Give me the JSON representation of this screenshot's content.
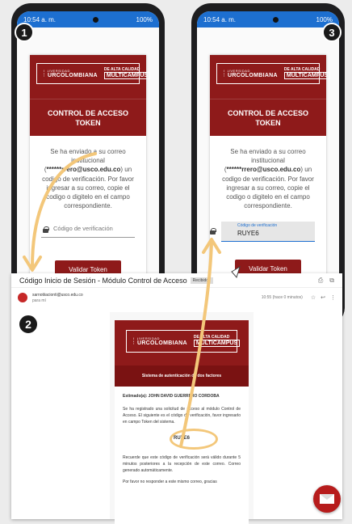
{
  "phone_left": {
    "status_time": "10:54 a. m.",
    "status_battery": "100%",
    "step_number": "1",
    "logo": {
      "small": "UNIVERSIDAD",
      "big": "SURCOLOMBIANA",
      "quality": "DE ALTA CALIDAD",
      "multi": "MULTICAMPUS"
    },
    "title_line1": "CONTROL DE ACCESO",
    "title_line2": "TOKEN",
    "msg_part1": "Se ha enviado a su correo institucional (",
    "msg_email": "******rrero@usco.edu.co",
    "msg_part2": ") un codigo de verificación. Por favor ingresar a su correo, copie el codigo o digitelo en el campo correspondiente.",
    "field_placeholder": "Código de verificación",
    "button_label": "Validar Token"
  },
  "phone_right": {
    "status_time": "10:54 a. m.",
    "status_battery": "100%",
    "step_number": "3",
    "title_line1": "CONTROL DE ACCESO",
    "title_line2": "TOKEN",
    "msg_part1": "Se ha enviado a su correo institucional (",
    "msg_email": "******rrero@usco.edu.co",
    "msg_part2": ") un codigo de verificación. Por favor ingresar a su correo, copie el codigo o digitelo en el campo correspondiente.",
    "field_label": "Código de verificación",
    "field_value": "RUYE6",
    "button_label": "Validar Token"
  },
  "email": {
    "step_number": "2",
    "subject": "Código Inicio de Sesión - Módulo Control de Acceso",
    "tag": "Recibidos",
    "sender": "sarnotiiacionti@usco.edu.co",
    "recipient": "para mí",
    "time": "10:55 (hace 0 minutos)",
    "band_text": "Sistema de autenticación de dos factores",
    "greeting": "Estimado(a): JOHN DAVID GUERRERO CORDOBA",
    "para1": "Se ha registrado una solicitud de acceso al módulo Control de Acceso. El siguiente es el código de verificación, favor ingresarlo en campo Token del sistema.",
    "token": "RUYE6",
    "para2": "Recuerde que este código de verificación será válido durante 5 minutos posteriores a la recepción de este correo. Correo generado automáticamente.",
    "para3": "Por favor no responder a este mismo correo, gracias"
  },
  "colors": {
    "brand": "#8e1a1a",
    "status_bar": "#1d6fd0",
    "arrow": "#f3c77a"
  },
  "icons": [
    "lock-icon",
    "envelope-icon",
    "avatar",
    "external-link-icon",
    "print-icon",
    "star-icon",
    "reply-icon",
    "more-icon"
  ]
}
